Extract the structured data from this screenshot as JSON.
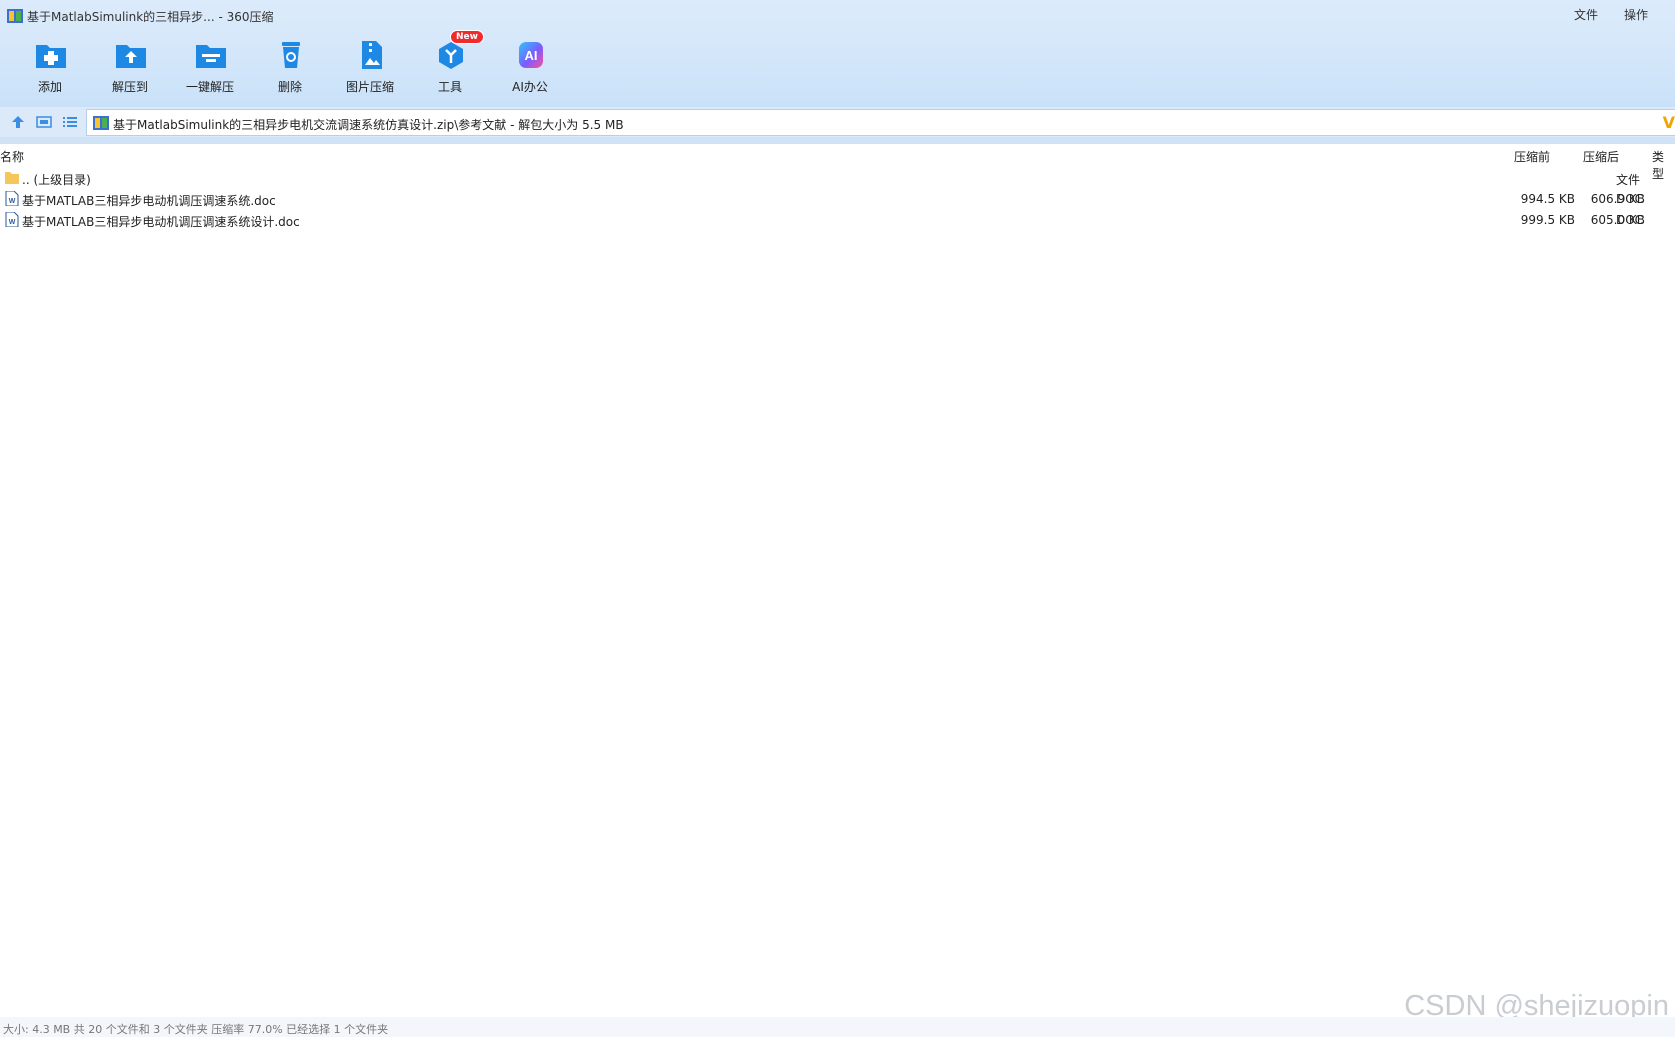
{
  "window": {
    "title": "基于MatlabSimulink的三相异步... - 360压缩",
    "menu": [
      "文件",
      "操作"
    ]
  },
  "toolbar": {
    "items": [
      {
        "label": "添加",
        "icon": "add-folder-icon"
      },
      {
        "label": "解压到",
        "icon": "extract-to-icon"
      },
      {
        "label": "一键解压",
        "icon": "one-click-extract-icon"
      },
      {
        "label": "删除",
        "icon": "delete-bin-icon"
      },
      {
        "label": "图片压缩",
        "icon": "image-compress-icon"
      },
      {
        "label": "工具",
        "icon": "tools-cube-icon"
      },
      {
        "label": "AI办公",
        "icon": "ai-office-icon"
      }
    ],
    "badge": "New"
  },
  "address": {
    "path": "基于MatlabSimulink的三相异步电机交流调速系统仿真设计.zip\\参考文献 - 解包大小为 5.5 MB",
    "vip_mark": "V"
  },
  "columns": {
    "name": "名称",
    "before": "压缩前",
    "after": "压缩后",
    "type": "类型"
  },
  "files": [
    {
      "name": ".. (上级目录)",
      "before": "",
      "after": "",
      "type": "文件",
      "icon": "folder-icon"
    },
    {
      "name": "基于MATLAB三相异步电动机调压调速系统.doc",
      "before": "994.5 KB",
      "after": "606.9 KB",
      "type": "DOC",
      "icon": "word-doc-icon"
    },
    {
      "name": "基于MATLAB三相异步电动机调压调速系统设计.doc",
      "before": "999.5 KB",
      "after": "605.0 KB",
      "type": "DOC",
      "icon": "word-doc-icon"
    }
  ],
  "status": "大小: 4.3 MB 共 20 个文件和 3 个文件夹 压缩率 77.0% 已经选择 1 个文件夹",
  "watermark": "CSDN @shejizuopin",
  "colors": {
    "accent": "#1e88e5",
    "toolbar_bg": "#d2e6fa",
    "badge": "#ef2b2b"
  }
}
